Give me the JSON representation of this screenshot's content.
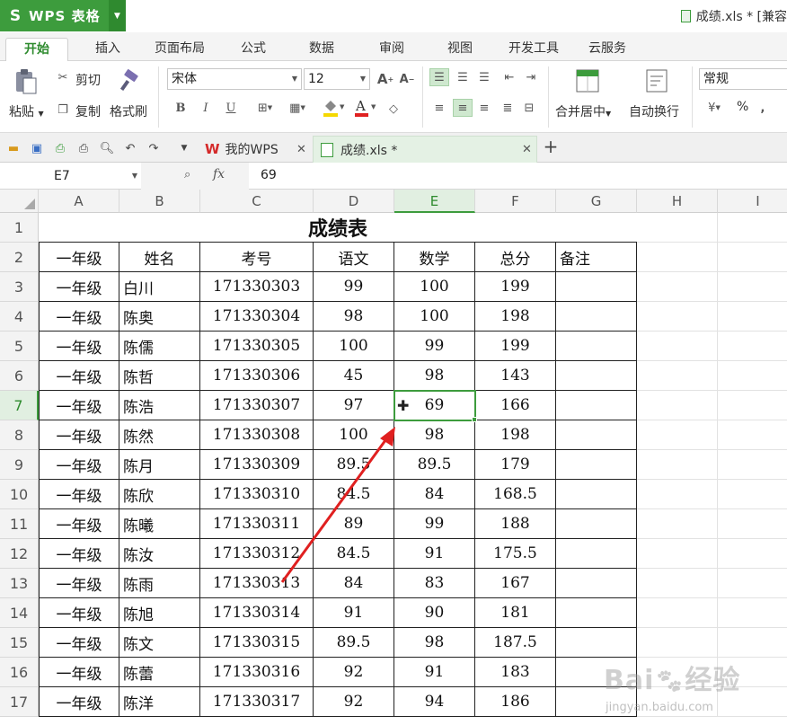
{
  "app": {
    "logo": "S",
    "name": "WPS 表格",
    "doc_title": "成绩.xls * [兼容"
  },
  "menu": {
    "tabs": [
      "开始",
      "插入",
      "页面布局",
      "公式",
      "数据",
      "审阅",
      "视图",
      "开发工具",
      "云服务"
    ],
    "active": 0
  },
  "ribbon": {
    "paste": "粘贴",
    "cut": "剪切",
    "copy": "复制",
    "format_painter": "格式刷",
    "font_name": "宋体",
    "font_size": "12",
    "merge_center": "合并居中",
    "wrap_text": "自动换行",
    "number_format": "常规",
    "percent": "%"
  },
  "doc_tabs": [
    {
      "label": "我的WPS"
    },
    {
      "label": "成绩.xls *"
    }
  ],
  "formula_bar": {
    "cell_ref": "E7",
    "fx": "fx",
    "value": "69"
  },
  "columns": [
    "A",
    "B",
    "C",
    "D",
    "E",
    "F",
    "G",
    "H",
    "I"
  ],
  "selected": {
    "col": "E",
    "row": 7
  },
  "sheet": {
    "title": "成绩表",
    "headers": [
      "一年级",
      "姓名",
      "考号",
      "语文",
      "数学",
      "总分",
      "备注"
    ],
    "rows": [
      [
        "一年级",
        "白川",
        "171330303",
        "99",
        "100",
        "199"
      ],
      [
        "一年级",
        "陈奥",
        "171330304",
        "98",
        "100",
        "198"
      ],
      [
        "一年级",
        "陈儒",
        "171330305",
        "100",
        "99",
        "199"
      ],
      [
        "一年级",
        "陈哲",
        "171330306",
        "45",
        "98",
        "143"
      ],
      [
        "一年级",
        "陈浩",
        "171330307",
        "97",
        "69",
        "166"
      ],
      [
        "一年级",
        "陈然",
        "171330308",
        "100",
        "98",
        "198"
      ],
      [
        "一年级",
        "陈月",
        "171330309",
        "89.5",
        "89.5",
        "179"
      ],
      [
        "一年级",
        "陈欣",
        "171330310",
        "84.5",
        "84",
        "168.5"
      ],
      [
        "一年级",
        "陈曦",
        "171330311",
        "89",
        "99",
        "188"
      ],
      [
        "一年级",
        "陈汝",
        "171330312",
        "84.5",
        "91",
        "175.5"
      ],
      [
        "一年级",
        "陈雨",
        "171330313",
        "84",
        "83",
        "167"
      ],
      [
        "一年级",
        "陈旭",
        "171330314",
        "91",
        "90",
        "181"
      ],
      [
        "一年级",
        "陈文",
        "171330315",
        "89.5",
        "98",
        "187.5"
      ],
      [
        "一年级",
        "陈蕾",
        "171330316",
        "92",
        "91",
        "183"
      ],
      [
        "一年级",
        "陈洋",
        "171330317",
        "92",
        "94",
        "186"
      ]
    ]
  },
  "watermark": {
    "brand": "Bai",
    "brand2": "经验",
    "url": "jingyan.baidu.com"
  },
  "colors": {
    "accent": "#3d9c3d",
    "arrow": "#e02020"
  }
}
